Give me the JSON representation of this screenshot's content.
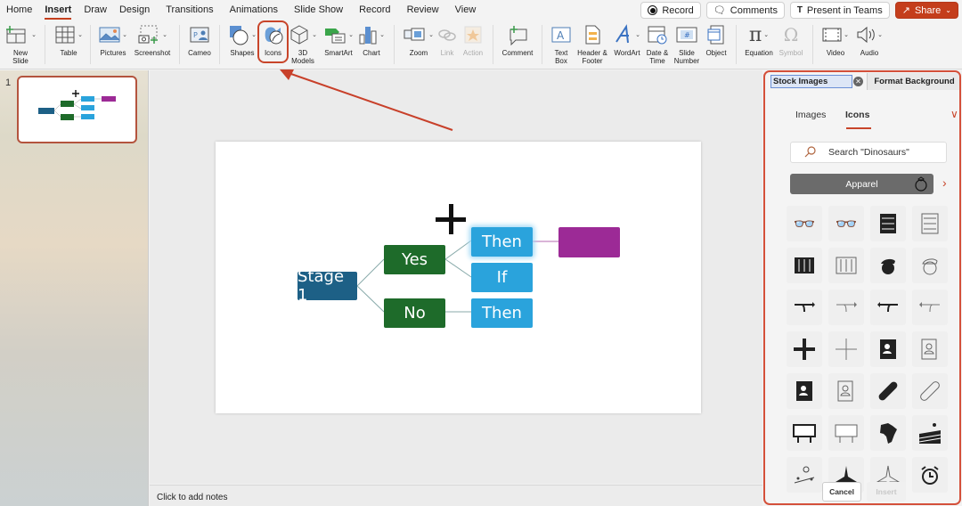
{
  "menu": {
    "tabs": [
      "Home",
      "Insert",
      "Draw",
      "Design",
      "Transitions",
      "Animations",
      "Slide Show",
      "Record",
      "Review",
      "View"
    ],
    "active_tab": "Insert",
    "record_label": "Record",
    "comments_label": "Comments",
    "present_label": "Present in Teams",
    "share_label": "Share"
  },
  "ribbon": {
    "new_slide": "New Slide",
    "table": "Table",
    "pictures": "Pictures",
    "screenshot": "Screenshot",
    "cameo": "Cameo",
    "shapes": "Shapes",
    "icons": "Icons",
    "models_3d": "3D Models",
    "smartart": "SmartArt",
    "chart": "Chart",
    "zoom": "Zoom",
    "link": "Link",
    "action": "Action",
    "comment": "Comment",
    "text_box": "Text Box",
    "header_footer": "Header & Footer",
    "wordart": "WordArt",
    "date_time": "Date & Time",
    "slide_number": "Slide Number",
    "object": "Object",
    "equation": "Equation",
    "symbol": "Symbol",
    "video": "Video",
    "audio": "Audio"
  },
  "thumbnails": {
    "number": "1"
  },
  "slide": {
    "nodes": {
      "stage": "Stage 1",
      "yes": "Yes",
      "no": "No",
      "then1": "Then",
      "if": "If",
      "then2": "Then"
    },
    "colors": {
      "stage": "#1d6086",
      "yesno": "#1e6b2a",
      "leaf": "#2aa3dc",
      "purple": "#9c2a96"
    }
  },
  "notes": {
    "placeholder": "Click to add notes"
  },
  "panel": {
    "tab_stock": "Stock Images",
    "tab_format": "Format Background",
    "subtabs": [
      "Images",
      "Icons"
    ],
    "active_subtab": "Icons",
    "search_placeholder": "Search \"Dinosaurs\"",
    "category": "Apparel",
    "icons": [
      "3d-glasses-filled",
      "3d-glasses-outline",
      "abacus-filled",
      "abacus-outline",
      "abacus-vertical-filled",
      "abacus-vertical-outline",
      "acorn-filled",
      "acorn-outline",
      "merge-right-filled",
      "merge-right-outline",
      "merge-left-filled",
      "merge-left-outline",
      "add-filled",
      "add-outline",
      "address-book-filled",
      "address-book-outline",
      "address-book-2-filled",
      "address-book-2-outline",
      "bandage-filled",
      "bandage-outline",
      "billboard-filled",
      "billboard-outline",
      "africa",
      "agriculture",
      "landscape-sun",
      "airplane-filled",
      "airplane-outline",
      "alarm-clock"
    ],
    "cancel_label": "Cancel",
    "insert_label": "Insert"
  }
}
